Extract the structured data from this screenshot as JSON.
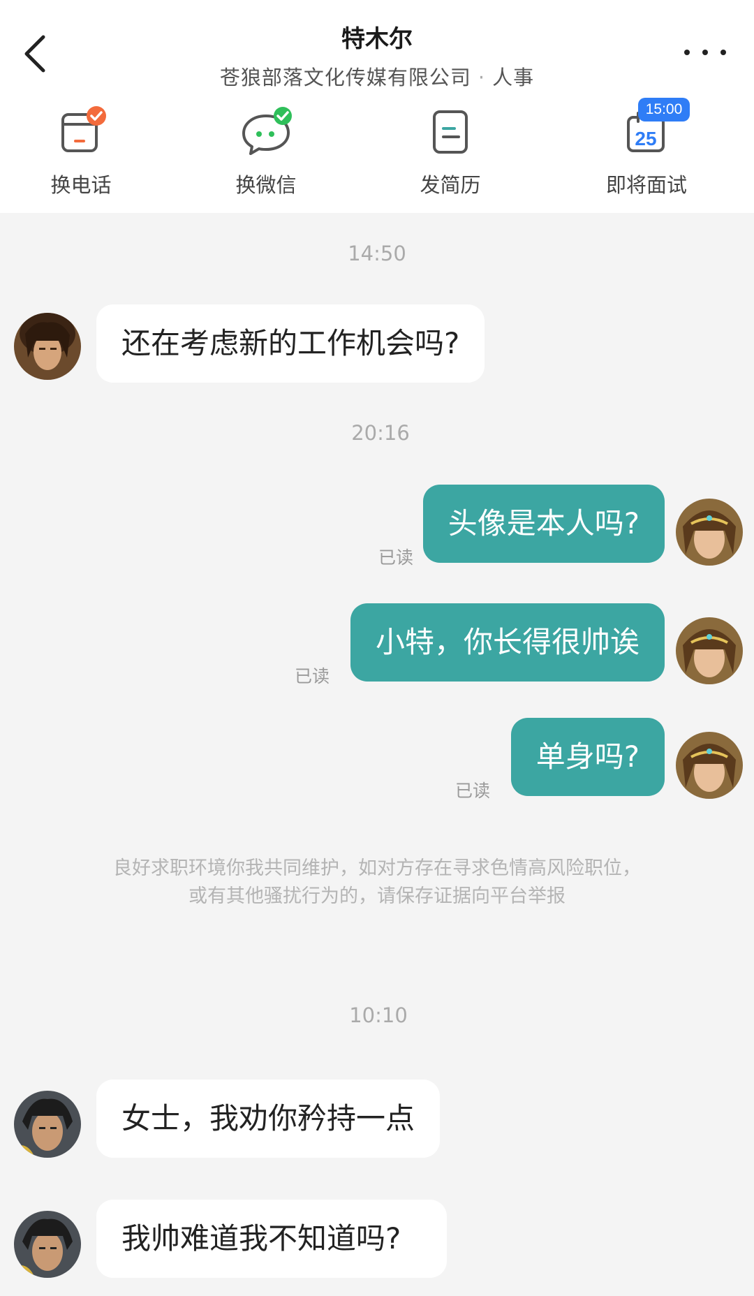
{
  "header": {
    "title": "特木尔",
    "company": "苍狼部落文化传媒有限公司",
    "separator": "·",
    "position": "人事"
  },
  "actions": [
    {
      "label": "换电话",
      "icon": "phone-swap-icon"
    },
    {
      "label": "换微信",
      "icon": "wechat-swap-icon"
    },
    {
      "label": "发简历",
      "icon": "resume-icon"
    },
    {
      "label": "即将面试",
      "icon": "calendar-icon",
      "date": "25",
      "badge_time": "15:00"
    }
  ],
  "chat": {
    "timestamps": [
      "14:50",
      "20:16",
      "10:10"
    ],
    "messages": [
      {
        "side": "in",
        "text": "还在考虑新的工作机会吗?"
      },
      {
        "side": "out",
        "text": "头像是本人吗?",
        "status": "已读"
      },
      {
        "side": "out",
        "text": "小特，你长得很帅诶",
        "status": "已读"
      },
      {
        "side": "out",
        "text": "单身吗?",
        "status": "已读"
      },
      {
        "side": "in",
        "text": "女士，我劝你矜持一点"
      },
      {
        "side": "in",
        "text": "我帅难道我不知道吗?"
      }
    ],
    "notice_line1": "良好求职环境你我共同维护，如对方存在寻求色情高风险职位，",
    "notice_line2": "或有其他骚扰行为的，请保存证据向平台举报"
  },
  "colors": {
    "accent": "#3ca6a2",
    "badge_blue": "#2f7df6",
    "check_green": "#2fbf5a",
    "check_orange": "#f36b3c"
  }
}
